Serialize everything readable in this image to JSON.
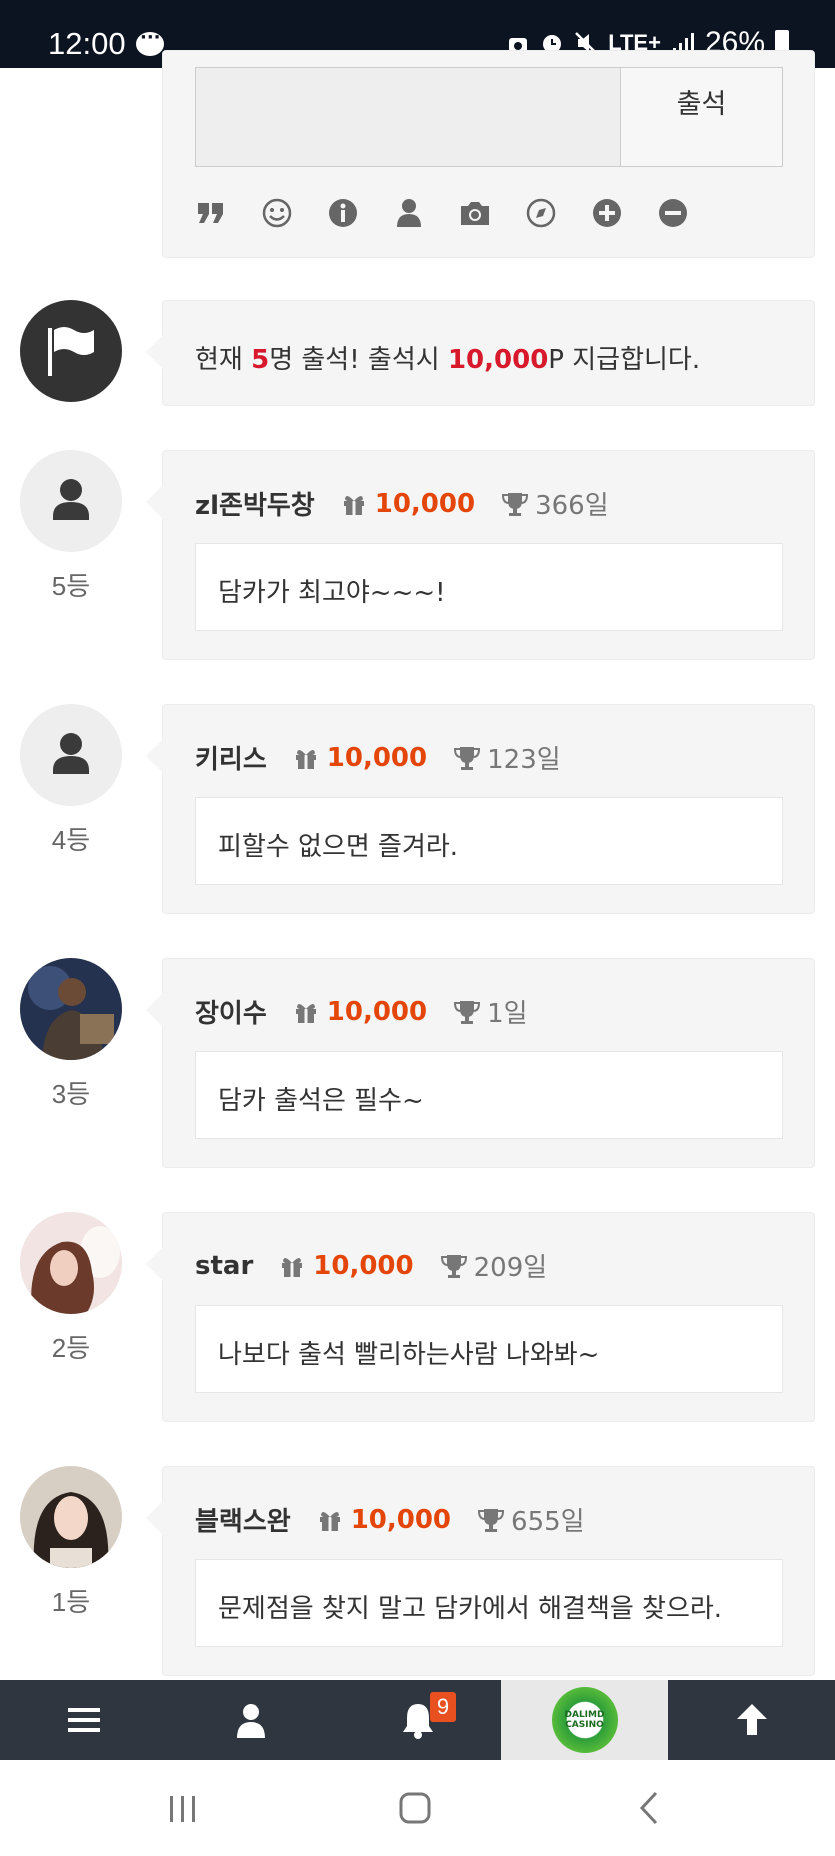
{
  "status_bar": {
    "time": "12:00",
    "network": "LTE+",
    "battery": "26%",
    "icons": [
      "chat-icon",
      "vpn-icon",
      "alarm-icon",
      "mute-icon",
      "lte-icon",
      "signal-icon",
      "battery-icon"
    ]
  },
  "editor": {
    "submit_label": "출석",
    "toolbar_icons": [
      "quote-icon",
      "smile-icon",
      "info-icon",
      "user-icon",
      "camera-icon",
      "compass-icon",
      "plus-circle-icon",
      "minus-circle-icon"
    ]
  },
  "announcement": {
    "prefix": "현재 ",
    "count": "5",
    "middle": "명 출석! 출석시 ",
    "points": "10,000",
    "suffix": "P 지급합니다."
  },
  "entries": [
    {
      "rank": "5등",
      "name": "zl존박두창",
      "points": "10,000",
      "days": "366일",
      "message": "담카가 최고야~~~!",
      "avatar": "default"
    },
    {
      "rank": "4등",
      "name": "키리스",
      "points": "10,000",
      "days": "123일",
      "message": "피할수 없으면 즐겨라.",
      "avatar": "default"
    },
    {
      "rank": "3등",
      "name": "장이수",
      "points": "10,000",
      "days": "1일",
      "message": "담카 출석은 필수~",
      "avatar": "photo-man"
    },
    {
      "rank": "2등",
      "name": "star",
      "points": "10,000",
      "days": "209일",
      "message": "나보다 출석 빨리하는사람 나와봐~",
      "avatar": "photo-woman"
    },
    {
      "rank": "1등",
      "name": "블랙스완",
      "points": "10,000",
      "days": "655일",
      "message": "문제점을 찾지 말고 담카에서 해결책을 찾으라.",
      "avatar": "photo-girl"
    }
  ],
  "bottom_nav": {
    "items": [
      "menu-icon",
      "user-icon",
      "bell-icon",
      "logo",
      "arrow-up-icon"
    ],
    "notification_count": "9",
    "logo_text": "DALIMD CASINO"
  },
  "colors": {
    "accent_points": "#e4460a",
    "accent_red": "#d7192b",
    "status_bar": "#0d1421",
    "nav_bar": "#2f3640"
  }
}
